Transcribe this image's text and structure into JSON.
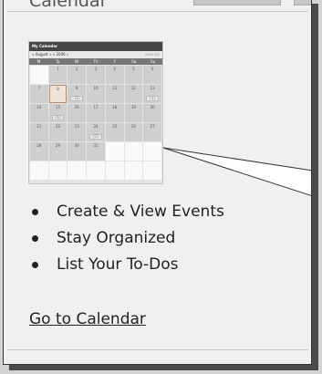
{
  "panel": {
    "title": "Calendar"
  },
  "thumbnail": {
    "calendar_title": "My Calendar",
    "prev_label": "«",
    "month": "August",
    "next_label": "»",
    "year_prev": "«",
    "year": "2006",
    "year_next": "»",
    "nav_right": "view list",
    "weekdays": [
      "M",
      "Tu",
      "W",
      "Th",
      "F",
      "Sa",
      "Su"
    ],
    "weeks": [
      [
        "",
        "1",
        "2",
        "3",
        "4",
        "5",
        "6"
      ],
      [
        "7",
        "8",
        "9",
        "10",
        "11",
        "12",
        "13"
      ],
      [
        "14",
        "15",
        "16",
        "17",
        "18",
        "19",
        "20"
      ],
      [
        "21",
        "22",
        "23",
        "24",
        "25",
        "26",
        "27"
      ],
      [
        "28",
        "29",
        "30",
        "31",
        "",
        "",
        ""
      ],
      [
        "",
        "",
        "",
        "",
        "",
        "",
        ""
      ]
    ],
    "event_label": "(1)"
  },
  "features": [
    {
      "label": "Create & View Events"
    },
    {
      "label": "Stay Organized"
    },
    {
      "label": "List Your To-Dos"
    }
  ],
  "link": {
    "label": "Go to Calendar"
  }
}
